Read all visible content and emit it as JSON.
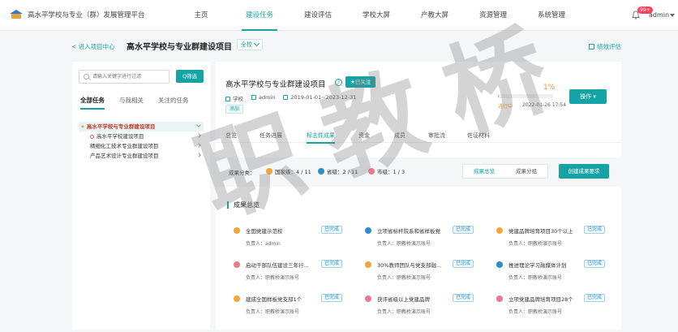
{
  "app": {
    "title": "高水平学校与专业（群）发展管理平台",
    "nav": [
      "主页",
      "建设任务",
      "建设评估",
      "学校大屏",
      "产教大屏",
      "资源管理",
      "系统管理"
    ],
    "active_nav": "建设任务",
    "notif_badge": "99+",
    "user": "admin"
  },
  "page": {
    "back_link": "< 进入项目中心",
    "title": "高水平学校与专业群建设项目",
    "scope_label": "全校",
    "perf_link": "绩效评估"
  },
  "left": {
    "search_placeholder": "请输入关键字进行过滤",
    "search_btn": "Q筛选",
    "tabs": [
      "全部任务",
      "与我相关",
      "关注的任务"
    ],
    "tree": [
      {
        "label": "高水平学校与专业群建设项目",
        "level": 0
      },
      {
        "label": "高水平学校建设项目",
        "level": 1
      },
      {
        "label": "精细化工技术专业群建设项目",
        "level": 1
      },
      {
        "label": "产品艺术设计专业群建设项目",
        "level": 1
      }
    ]
  },
  "project": {
    "title": "高水平学校与专业群建设项目",
    "help": "?",
    "follow_btn": "★已关注",
    "meta": {
      "scope": "学校",
      "owner": "admin",
      "period": "2019-01-01~2023-12-31"
    },
    "tag": "添加",
    "progress_pct": "1%",
    "progress_value": 1,
    "progress_state": "进行中",
    "progress_date": "2022-01-26 17:54",
    "op_btn": "操作 ▾",
    "tabs": [
      "总览",
      "任务进展",
      "标志性成果",
      "资金",
      "成员",
      "审批流",
      "佐证材料"
    ],
    "active_tab": "标志性成果"
  },
  "classification": {
    "label": "成果分类：",
    "items": [
      {
        "name": "国家级：4 / 11",
        "color": "#f2a53a"
      },
      {
        "name": "省级：2 / 11",
        "color": "#2b8dc9"
      },
      {
        "name": "市级：1 / 3",
        "color": "#e87b8b"
      }
    ],
    "seg": [
      "成果总览",
      "成果分组"
    ],
    "seg_active": "成果总览",
    "create_btn": "创建成果要求"
  },
  "overview": {
    "title": "成果总览",
    "cards": [
      {
        "title": "全国党建示范校",
        "owner": "负责人：admin",
        "status": "已完成",
        "color": "#f2a53a"
      },
      {
        "title": "立项省标杆院系和省样板党",
        "owner": "负责人：职教桥演示账号",
        "status": "已完成",
        "color": "#2b8dc9"
      },
      {
        "title": "党建品牌培育项目30个以上",
        "owner": "负责人：职教桥演示账号",
        "status": "已完成",
        "color": "#f2a53a"
      },
      {
        "title": "启动干部队伍建设三年行...",
        "owner": "负责人：职教桥演示账号",
        "status": "已完成",
        "color": "#e87b8b"
      },
      {
        "title": "30%教师团队与党支部融...",
        "owner": "负责人：职教桥演示账号",
        "status": "已完成",
        "color": "#f2a53a"
      },
      {
        "title": "推进理论学习融媒体计划",
        "owner": "负责人：职教桥演示账号",
        "status": "已完成",
        "color": "#2b8dc9"
      },
      {
        "title": "建成全国样板党支部1个",
        "owner": "负责人：职教桥演示账号",
        "status": "已完成",
        "color": "#f2a53a"
      },
      {
        "title": "获评省级以上党建品牌",
        "owner": "负责人：职教桥演示账号",
        "status": "已完成",
        "color": "#e87b8b"
      },
      {
        "title": "立项党建品牌培育项目28个",
        "owner": "负责人：职教桥演示账号",
        "status": "已完成",
        "color": "#e87b8b"
      }
    ]
  },
  "watermark": "职教桥"
}
